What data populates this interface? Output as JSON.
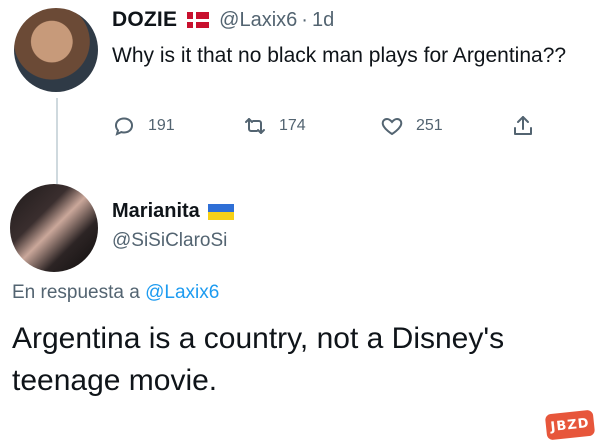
{
  "tweet": {
    "author_name": "DOZIE",
    "author_handle": "@Laxix6",
    "separator": "·",
    "time": "1d",
    "text": "Why is it that no black man plays for Argentina??",
    "reply_count": "191",
    "retweet_count": "174",
    "like_count": "251"
  },
  "reply": {
    "author_name": "Marianita",
    "author_handle": "@SiSiClaroSi",
    "reply_prefix": "En respuesta a",
    "reply_mention": "@Laxix6",
    "text": "Argentina is a country, not a Disney's teenage movie."
  },
  "watermark": {
    "text": "JBZD"
  },
  "colors": {
    "text_primary": "#0f1419",
    "text_secondary": "#536471",
    "link": "#1d9bf0",
    "thread_line": "#cfd9de"
  },
  "icons": {
    "reply": "reply-icon",
    "retweet": "retweet-icon",
    "like": "heart-icon",
    "share": "share-icon"
  }
}
